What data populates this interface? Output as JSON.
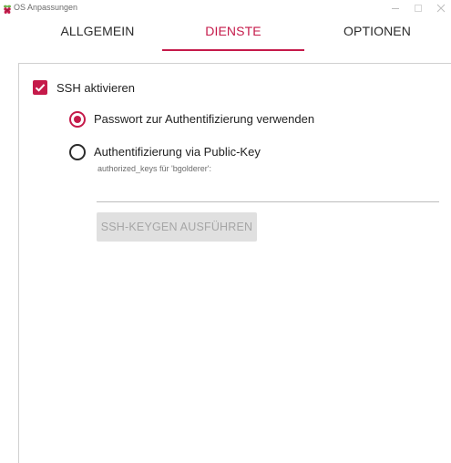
{
  "window": {
    "title": "OS Anpassungen",
    "icon": "raspberry-icon"
  },
  "tabs": [
    {
      "label": "ALLGEMEIN",
      "active": false
    },
    {
      "label": "DIENSTE",
      "active": true
    },
    {
      "label": "OPTIONEN",
      "active": false
    }
  ],
  "services": {
    "ssh_enable": {
      "label": "SSH aktivieren",
      "checked": true
    },
    "auth_password": {
      "label": "Passwort zur Authentifizierung verwenden",
      "selected": true
    },
    "auth_pubkey": {
      "label": "Authentifizierung via Public-Key",
      "selected": false
    },
    "authorized_keys": {
      "label": "authorized_keys für 'bgolderer':",
      "value": "",
      "placeholder": ""
    },
    "keygen_button": {
      "label": "SSH-KEYGEN AUSFÜHREN",
      "enabled": false
    }
  },
  "colors": {
    "accent": "#c51a4a",
    "disabled_button_bg": "#e0e0e0",
    "disabled_button_text": "#a6a6a6"
  }
}
